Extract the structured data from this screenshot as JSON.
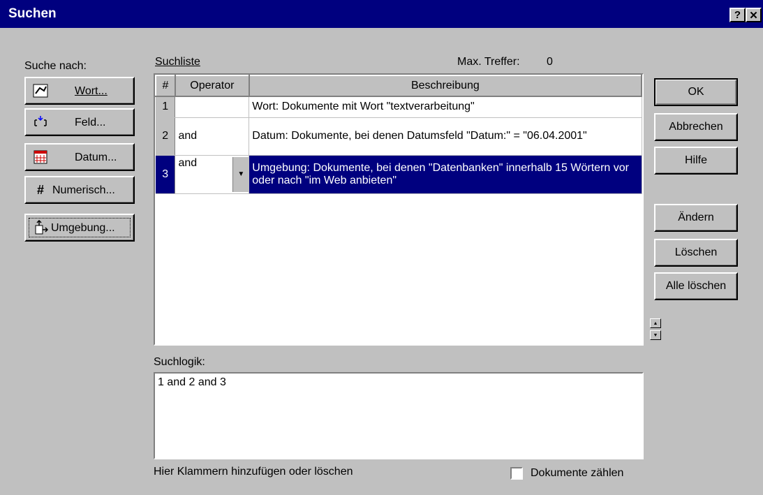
{
  "window": {
    "title": "Suchen",
    "help_btn": "?",
    "close_btn": "✕"
  },
  "left": {
    "heading": "Suche nach:",
    "buttons": [
      {
        "label": "Wort...",
        "icon": "word-icon"
      },
      {
        "label": "Feld...",
        "icon": "field-icon"
      },
      {
        "label": "Datum...",
        "icon": "calendar-icon"
      },
      {
        "label": "Numerisch...",
        "icon": "hash-icon"
      },
      {
        "label": "Umgebung...",
        "icon": "proximity-icon"
      }
    ]
  },
  "searchlist": {
    "label": "Suchliste",
    "max_label": "Max. Treffer:",
    "max_value": "0",
    "columns": [
      "#",
      "Operator",
      "Beschreibung"
    ],
    "rows": [
      {
        "num": "1",
        "op": "",
        "desc": "Wort: Dokumente mit Wort  \"textverarbeitung\""
      },
      {
        "num": "2",
        "op": "and",
        "desc": "Datum: Dokumente, bei denen Datumsfeld \"Datum:\" = \"06.04.2001\""
      },
      {
        "num": "3",
        "op": "and",
        "desc": "Umgebung: Dokumente, bei denen \"Datenbanken\" innerhalb 15 Wörtern vor oder nach  \"im Web anbieten\""
      }
    ]
  },
  "right": {
    "ok": "OK",
    "cancel": "Abbrechen",
    "help": "Hilfe",
    "change": "Ändern",
    "delete": "Löschen",
    "delete_all": "Alle löschen"
  },
  "logic": {
    "label": "Suchlogik:",
    "value": "1 and 2 and 3",
    "hint": "Hier Klammern hinzufügen oder löschen",
    "count_label": "Dokumente zählen"
  }
}
